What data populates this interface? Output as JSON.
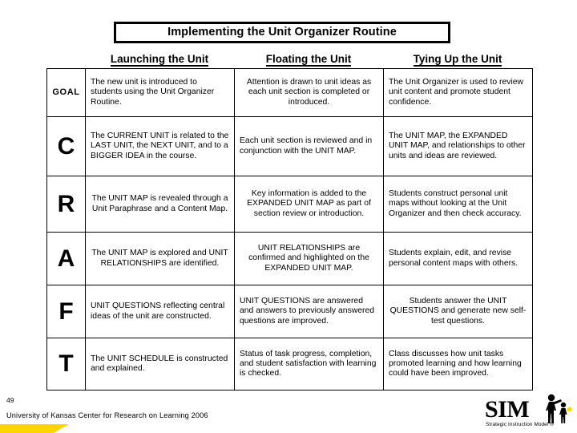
{
  "slide": {
    "title": "Implementing the Unit Organizer Routine",
    "page_number": "49",
    "credit": "University of Kansas Center for Research on Learning  2006"
  },
  "logo": {
    "wordmark": "SIM",
    "tagline": "Strategic Instruction Model ®"
  },
  "table": {
    "column_headers": [
      "Launching the Unit",
      "Floating the Unit",
      "Tying Up the Unit"
    ],
    "rows": [
      {
        "label": "GOAL",
        "launching": "The new unit is introduced to students using the Unit Organizer Routine.",
        "floating": "Attention is drawn to unit ideas as each unit section is completed or introduced.",
        "tying_up": "The Unit Organizer is used to review unit content and promote student confidence."
      },
      {
        "label": "C",
        "launching": "The CURRENT UNIT is related to the LAST UNIT, the NEXT UNIT, and to a BIGGER IDEA in the course.",
        "floating": "Each unit section is reviewed and in conjunction with the UNIT MAP.",
        "tying_up": "The UNIT MAP, the EXPANDED UNIT MAP, and relationships to other units and ideas are reviewed."
      },
      {
        "label": "R",
        "launching": "The UNIT MAP is revealed through a Unit Paraphrase and a Content Map.",
        "floating": "Key information is added to the EXPANDED UNIT MAP as part of section review or introduction.",
        "tying_up": "Students construct personal unit maps without looking at the Unit Organizer and then check accuracy."
      },
      {
        "label": "A",
        "launching": "The UNIT MAP is explored and UNIT RELATIONSHIPS are identified.",
        "floating": "UNIT RELATIONSHIPS are confirmed and highlighted on the EXPANDED UNIT MAP.",
        "tying_up": "Students explain, edit, and revise personal content maps with others."
      },
      {
        "label": "F",
        "launching": "UNIT QUESTIONS reflecting central ideas of the unit are constructed.",
        "floating": "UNIT QUESTIONS are answered and answers to previously answered  questions are improved.",
        "tying_up": "Students answer the UNIT QUESTIONS and generate new self-test questions."
      },
      {
        "label": "T",
        "launching": "The UNIT SCHEDULE is constructed and explained.",
        "floating": "Status of task progress, completion, and student satisfaction with learning is checked.",
        "tying_up": "Class discusses how unit tasks promoted learning and how learning could have been improved."
      }
    ]
  },
  "colors": {
    "accent_yellow": "#ffd500",
    "border": "#000000",
    "background": "#ffffff"
  }
}
